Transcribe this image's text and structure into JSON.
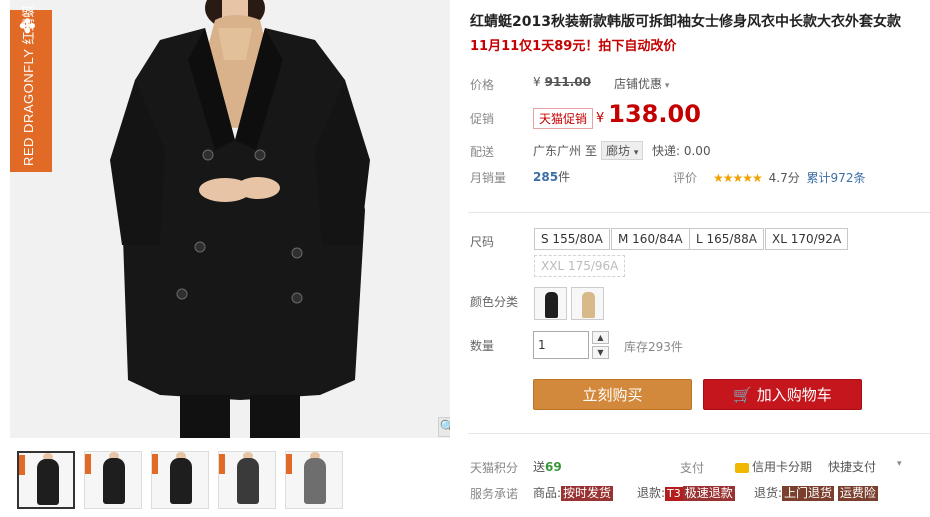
{
  "brand": {
    "label": "RED DRAGONFLY 红蜻蜓",
    "icon": "dragonfly-icon",
    "color": "#e06a26"
  },
  "product": {
    "title": "红蜻蜓2013秋装新款韩版可拆卸袖女士修身风衣中长款大衣外套女款",
    "subtitle": "11月11仅1天89元！拍下自动改价"
  },
  "price": {
    "label": "价格",
    "currency": "¥",
    "original": "911.00",
    "store_discount": "店铺优惠"
  },
  "promo": {
    "label": "促销",
    "badge": "天猫促销",
    "currency": "¥",
    "price": "138.00"
  },
  "shipping": {
    "label": "配送",
    "from": "广东广州",
    "to_word": "至",
    "to_city": "廊坊",
    "express": "快递: 0.00"
  },
  "sales": {
    "label": "月销量",
    "count": "285",
    "unit": "件",
    "rating_label": "评价",
    "stars": "★★★★★",
    "score": "4.7分",
    "reviews": "累计972条"
  },
  "size": {
    "label": "尺码",
    "options": [
      "S 155/80A",
      "M 160/84A",
      "L 165/88A",
      "XL 170/92A",
      "XXL 175/96A"
    ]
  },
  "color": {
    "label": "颜色分类",
    "swatches": [
      "#1e1e1e",
      "#d8b98a"
    ]
  },
  "quantity": {
    "label": "数量",
    "value": "1",
    "stock": "库存293件"
  },
  "buttons": {
    "buy_now": "立刻购买",
    "add_to_cart": "加入购物车"
  },
  "points": {
    "label": "天猫积分",
    "give": "送",
    "value": "69",
    "pay_label": "支付",
    "credit": "信用卡分期",
    "quick_pay": "快捷支付"
  },
  "service": {
    "label": "服务承诺",
    "goods_label": "商品:",
    "goods_tag": "按时发货",
    "refund_label": "退款:",
    "refund_t3": "T3",
    "refund_tag": "极速退款",
    "return_label": "退货:",
    "return_tag1": "上门退货",
    "return_tag2": "运费险"
  }
}
